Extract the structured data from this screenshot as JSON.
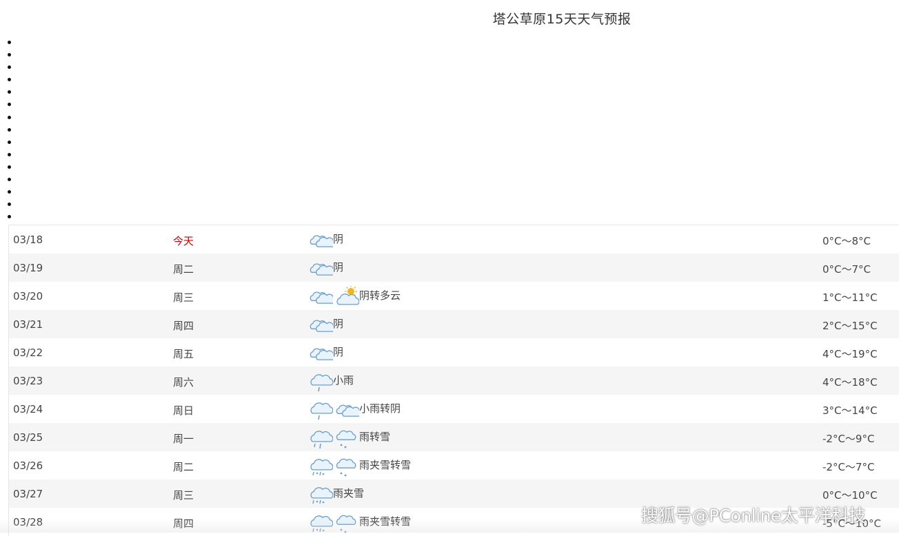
{
  "title": "塔公草原15天天气预报",
  "bullet_count": 15,
  "colors": {
    "today": "#cc0000",
    "cloud_stroke": "#6b9ec9",
    "cloud_fill": "#e8f3fb",
    "sun": "#f5b324"
  },
  "forecast": [
    {
      "date": "03/18",
      "weekday": "今天",
      "is_today": true,
      "icons": [
        "overcast-icon"
      ],
      "condition": "阴",
      "temp": "0°C～8°C"
    },
    {
      "date": "03/19",
      "weekday": "周二",
      "is_today": false,
      "icons": [
        "overcast-icon"
      ],
      "condition": "阴",
      "temp": "0°C～7°C"
    },
    {
      "date": "03/20",
      "weekday": "周三",
      "is_today": false,
      "icons": [
        "overcast-icon",
        "partly-cloudy-icon"
      ],
      "condition": "阴转多云",
      "temp": "1°C～11°C"
    },
    {
      "date": "03/21",
      "weekday": "周四",
      "is_today": false,
      "icons": [
        "overcast-icon"
      ],
      "condition": "阴",
      "temp": "2°C～15°C"
    },
    {
      "date": "03/22",
      "weekday": "周五",
      "is_today": false,
      "icons": [
        "overcast-icon"
      ],
      "condition": "阴",
      "temp": "4°C～19°C"
    },
    {
      "date": "03/23",
      "weekday": "周六",
      "is_today": false,
      "icons": [
        "light-rain-icon"
      ],
      "condition": "小雨",
      "temp": "4°C～18°C"
    },
    {
      "date": "03/24",
      "weekday": "周日",
      "is_today": false,
      "icons": [
        "light-rain-icon",
        "overcast-icon"
      ],
      "condition": "小雨转阴",
      "temp": "3°C～14°C"
    },
    {
      "date": "03/25",
      "weekday": "周一",
      "is_today": false,
      "icons": [
        "rain-icon",
        "snow-icon"
      ],
      "condition": "雨转雪",
      "temp": "-2°C～9°C"
    },
    {
      "date": "03/26",
      "weekday": "周二",
      "is_today": false,
      "icons": [
        "sleet-icon",
        "snow-icon"
      ],
      "condition": "雨夹雪转雪",
      "temp": "-2°C～7°C"
    },
    {
      "date": "03/27",
      "weekday": "周三",
      "is_today": false,
      "icons": [
        "sleet-icon"
      ],
      "condition": "雨夹雪",
      "temp": "0°C～10°C"
    },
    {
      "date": "03/28",
      "weekday": "周四",
      "is_today": false,
      "icons": [
        "sleet-icon",
        "snow-icon"
      ],
      "condition": "雨夹雪转雪",
      "temp": "-5°C～10°C"
    }
  ],
  "watermark": "搜狐号@PConline太平洋科技"
}
